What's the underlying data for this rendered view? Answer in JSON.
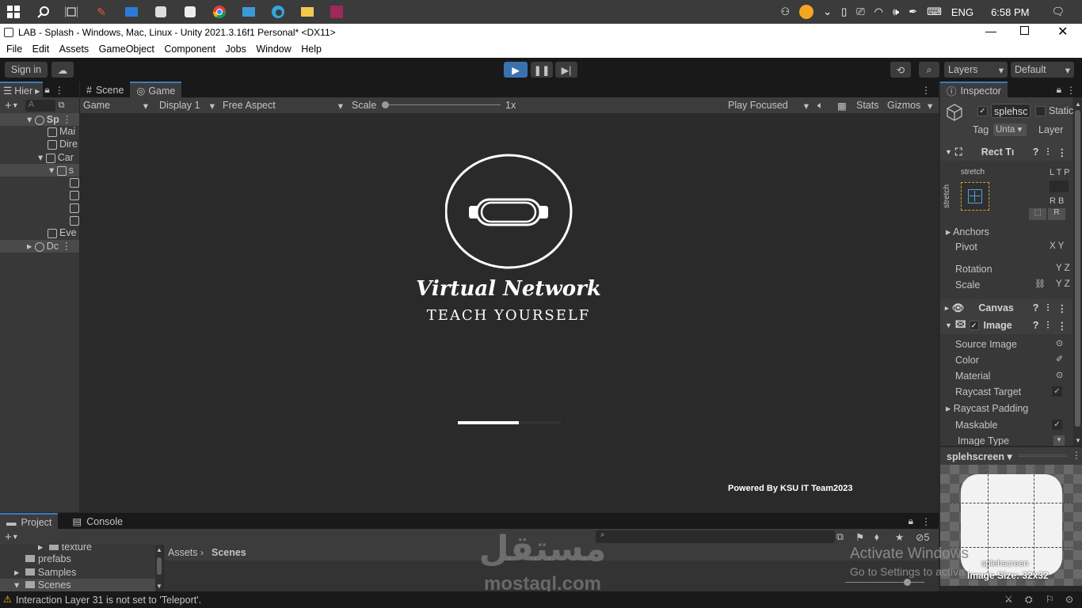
{
  "taskbar": {
    "lang": "ENG",
    "time": "6:58 PM"
  },
  "window": {
    "title": "LAB - Splash - Windows, Mac, Linux - Unity 2021.3.16f1 Personal* <DX11>"
  },
  "menu": [
    "File",
    "Edit",
    "Assets",
    "GameObject",
    "Component",
    "Jobs",
    "Window",
    "Help"
  ],
  "toolbar": {
    "sign_in": "Sign in",
    "layers": "Layers",
    "layout": "Default"
  },
  "hierarchy": {
    "tab": "Hier",
    "search_placeholder": "A",
    "items": [
      {
        "label": "Sp",
        "indent": 0
      },
      {
        "label": "Mai",
        "indent": 2
      },
      {
        "label": "Dire",
        "indent": 2
      },
      {
        "label": "Car",
        "indent": 1
      },
      {
        "label": "s",
        "indent": 2
      },
      {
        "label": "",
        "indent": 3
      },
      {
        "label": "",
        "indent": 3
      },
      {
        "label": "",
        "indent": 3
      },
      {
        "label": "",
        "indent": 3
      },
      {
        "label": "Eve",
        "indent": 2
      },
      {
        "label": "Dc",
        "indent": 0
      }
    ]
  },
  "view": {
    "tab_scene": "Scene",
    "tab_game": "Game",
    "mode": "Game",
    "display": "Display 1",
    "aspect": "Free Aspect",
    "scale_label": "Scale",
    "scale_value": "1x",
    "play_focused": "Play Focused",
    "stats": "Stats",
    "gizmos": "Gizmos"
  },
  "game": {
    "title": "Virtual Network",
    "subtitle": "TEACH YOURSELF",
    "progress": 0.59,
    "footer": "Powered By KSU IT Team2023"
  },
  "inspector": {
    "tab": "Inspector",
    "object_name": "splehsc",
    "static_label": "Static",
    "tag_label": "Tag",
    "tag_value": "Unta",
    "layer_label": "Layer",
    "rect_transform": "Rect Tı",
    "stretch": "stretch",
    "ltp": "L T P",
    "rb": "R B",
    "anchors": "Anchors",
    "pivot": "Pivot",
    "pivot_xy": "X Y",
    "rotation": "Rotation",
    "scale": "Scale",
    "xyz": "Y Z",
    "canvas": "Canvas",
    "image": "Image",
    "props": [
      "Source Image",
      "Color",
      "Material",
      "Raycast Target",
      "Raycast Padding",
      "Maskable",
      "Image Type"
    ],
    "preview_name": "splehscreen",
    "preview_caption": "splehscreen",
    "image_size": "Image Size: 32x32"
  },
  "project": {
    "tab_project": "Project",
    "tab_console": "Console",
    "tree": [
      "texture",
      "prefabs",
      "Samples",
      "Scenes"
    ],
    "breadcrumb_root": "Assets",
    "breadcrumb_leaf": "Scenes",
    "hidden_count": "5"
  },
  "watermark": {
    "activate_title": "Activate Windows",
    "activate_sub": "Go to Settings to activa",
    "logo_ar": "مستقل",
    "logo_en": "mostaql.com"
  },
  "status": {
    "message": "Interaction Layer 31 is not set to 'Teleport'."
  },
  "colors": {
    "accent": "#3a79bb",
    "play_active": "#3a72b0",
    "warning": "#f0c030"
  }
}
